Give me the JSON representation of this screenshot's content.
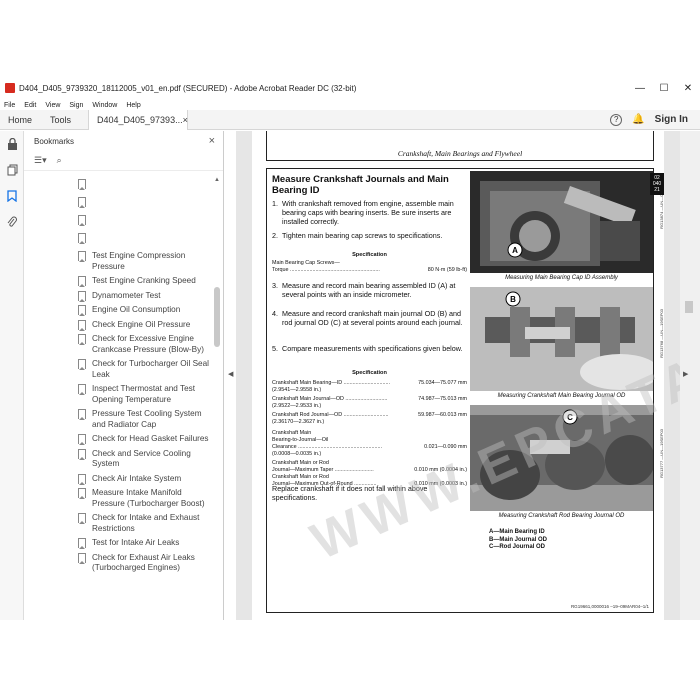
{
  "window": {
    "title": "D404_D405_9739320_18112005_v01_en.pdf (SECURED) - Adobe Acrobat Reader DC (32-bit)",
    "controls": [
      "—",
      "☐",
      "✕"
    ]
  },
  "menu": [
    "File",
    "Edit",
    "View",
    "Sign",
    "Window",
    "Help"
  ],
  "tabs": {
    "home": "Home",
    "tools": "Tools",
    "doc": "D404_D405_97393...",
    "doc_close": "×",
    "sign_in": "Sign In",
    "help": "?",
    "bell": "🔔"
  },
  "left_tools": [
    "lock-icon",
    "copy-pages-icon",
    "bookmark-icon",
    "attachment-icon"
  ],
  "bookmarks": {
    "title": "Bookmarks",
    "close": "×",
    "items": [
      "",
      "",
      "",
      "",
      "Test Engine Compression Pressure",
      "Test Engine Cranking Speed",
      "Dynamometer Test",
      "Engine Oil Consumption",
      "Check Engine Oil Pressure",
      "Check for Excessive Engine Crankcase Pressure (Blow-By)",
      "Check for Turbocharger Oil Seal Leak",
      "Inspect Thermostat and Test Opening Temperature",
      "Pressure Test Cooling System and Radiator Cap",
      "Check for Head Gasket Failures",
      "Check and Service Cooling System",
      "Check Air Intake System",
      "Measure Intake Manifold Pressure (Turbocharger Boost)",
      "Check for Intake and Exhaust Restrictions",
      "Test for Intake Air Leaks",
      "Check for Exhaust Air Leaks (Turbocharged Engines)"
    ]
  },
  "page": {
    "running_head": "Crankshaft, Main Bearings and Flywheel",
    "section_title": "Measure Crankshaft Journals and Main Bearing ID",
    "step1": "With crankshaft removed from engine, assemble main bearing caps with bearing inserts. Be sure inserts are installed correctly.",
    "step2": "Tighten main bearing cap screws to specifications.",
    "spec1_head": "Specification",
    "spec1_label": "Main Bearing Cap Screws—",
    "spec1_torque_label": "Torque ............................................................",
    "spec1_torque_value": "80 N·m (59 lb-ft)",
    "step3": "Measure and record main bearing assembled ID (A) at several points with an inside micrometer.",
    "step4": "Measure and record crankshaft main journal OD (B) and rod journal OD (C) at several points around each journal.",
    "step5": "Compare measurements with specifications given below.",
    "spec2_head": "Specification",
    "specs": [
      {
        "label": "Crankshaft Main Bearing—ID ...............................",
        "value": "75.034—75.077 mm",
        "value2": "(2.9541—2.9558 in.)"
      },
      {
        "label": "Crankshaft Main Journal—OD ............................",
        "value": "74.987—75.013 mm",
        "value2": "(2.9522—2.9533 in.)"
      },
      {
        "label": "Crankshaft Rod Journal—OD ..............................",
        "value": "59.987—60.013 mm",
        "value2": "(2.36170—2.3627 in.)"
      }
    ],
    "clearance_label1": "Crankshaft Main",
    "clearance_label2": "Bearing-to-Journal—Oil",
    "clearance_label3": "Clearance ........................................................",
    "clearance_value": "0.021—0.090 mm",
    "clearance_value2": "(0.0008—0.0035 in.)",
    "taper_label1": "Crankshaft Main or Rod",
    "taper_label2": "Journal—Maximum Taper ..........................",
    "taper_value": "0.010 mm (0.0004 in.)",
    "oor_label1": "Crankshaft Main or Rod",
    "oor_label2": "Journal—Maximum Out-of-Round ...............",
    "oor_value": "0.010 mm (0.0003 in.)",
    "replace_note": "Replace crankshaft if it does not fall within above specifications.",
    "caption1": "Measuring Main Bearing Cap ID Assembly",
    "caption2": "Measuring Crankshaft Main Bearing Journal OD",
    "caption3": "Measuring Crankshaft Rod Bearing Journal OD",
    "callout_a": "A",
    "callout_b": "B",
    "callout_c": "C",
    "legend_a": "A—Main Bearing ID",
    "legend_b": "B—Main Journal OD",
    "legend_c": "C—Rod Journal OD",
    "side_tab": [
      "02",
      "040",
      "21"
    ],
    "footer": "RG19661,0000016  –19–09MAR04–1/1",
    "photo_id1": "RG13874 —UN—03MAR04",
    "photo_id2": "RG13768 —UN—19SEP03",
    "photo_id3": "RG13777 —UN—19SEP03"
  },
  "watermark": "WWW.EPCATALOGS.COM"
}
